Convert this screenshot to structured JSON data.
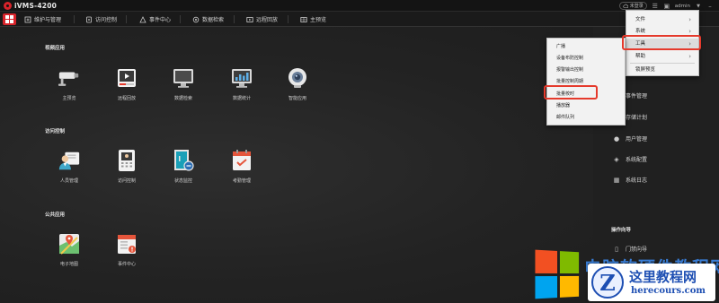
{
  "app": {
    "title": "iVMS-4200"
  },
  "titlebar": {
    "cloud_label": "未登录",
    "user": "admin"
  },
  "nav": {
    "tabs": [
      {
        "label": "维护与管理",
        "icon": "maintenance-icon"
      },
      {
        "label": "访问控制",
        "icon": "access-icon"
      },
      {
        "label": "事件中心",
        "icon": "event-icon"
      },
      {
        "label": "数据检索",
        "icon": "search-icon"
      },
      {
        "label": "远程回放",
        "icon": "playback-icon"
      },
      {
        "label": "主预览",
        "icon": "preview-icon"
      }
    ]
  },
  "sections": {
    "video": {
      "title": "视频应用",
      "apps": [
        {
          "label": "主预览",
          "icon": "cctv-camera-icon"
        },
        {
          "label": "远程回放",
          "icon": "playback-player-icon"
        },
        {
          "label": "数据检索",
          "icon": "monitor-icon"
        },
        {
          "label": "数据统计",
          "icon": "statistics-icon"
        },
        {
          "label": "智能应用",
          "icon": "smart-camera-icon"
        }
      ]
    },
    "access": {
      "title": "访问控制",
      "apps": [
        {
          "label": "人员管理",
          "icon": "person-management-icon"
        },
        {
          "label": "访问控制",
          "icon": "access-terminal-icon"
        },
        {
          "label": "状态监控",
          "icon": "door-monitor-icon"
        },
        {
          "label": "考勤管理",
          "icon": "attendance-calendar-icon"
        }
      ]
    },
    "public": {
      "title": "公共应用",
      "apps": [
        {
          "label": "电子地图",
          "icon": "map-icon"
        },
        {
          "label": "事件中心",
          "icon": "event-center-icon"
        }
      ]
    }
  },
  "right_panel": {
    "items": [
      {
        "label": "事件管理",
        "icon": "event-manage-icon"
      },
      {
        "label": "存储计划",
        "icon": "storage-icon"
      },
      {
        "label": "用户管理",
        "icon": "user-icon"
      },
      {
        "label": "系统配置",
        "icon": "config-icon"
      },
      {
        "label": "系统日志",
        "icon": "log-icon"
      }
    ],
    "guide_title": "操作向导",
    "guide_items": [
      {
        "label": "门禁向导",
        "icon": "door-guide-icon"
      }
    ]
  },
  "main_menu": {
    "items": [
      {
        "label": "文件",
        "has_submenu": true
      },
      {
        "label": "系统",
        "has_submenu": true
      },
      {
        "label": "工具",
        "has_submenu": true,
        "highlighted": true
      },
      {
        "label": "帮助",
        "has_submenu": true
      },
      {
        "label": "锁屏预览",
        "has_submenu": false
      }
    ]
  },
  "tools_submenu": {
    "items": [
      {
        "label": "广播"
      },
      {
        "label": "设备布防控制"
      },
      {
        "label": "报警输出控制"
      },
      {
        "label": "批量控制周期"
      },
      {
        "label": "批量校时",
        "highlighted": true
      },
      {
        "label": "播放器"
      },
      {
        "label": "邮件队列"
      }
    ]
  },
  "watermark": {
    "big_text": "电脑软硬件教程网",
    "site_name": "这里教程网",
    "url": "herecours.com"
  },
  "colors": {
    "accent": "#d8232a",
    "highlight_box": "#e53a2c",
    "watermark_blue": "#1e4fb3"
  }
}
